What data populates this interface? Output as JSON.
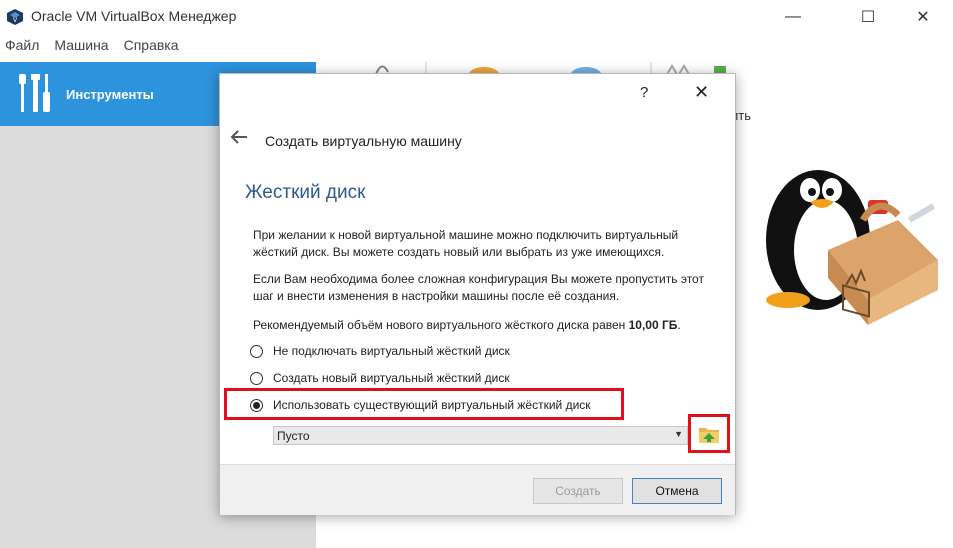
{
  "window": {
    "title": "Oracle VM VirtualBox Менеджер",
    "minimize_glyph": "—",
    "maximize_glyph": "☐",
    "close_glyph": "✕"
  },
  "menu": [
    "Файл",
    "Машина",
    "Справка"
  ],
  "sidebar": {
    "tools_label": "Инструменты"
  },
  "right_panel": {
    "partial_label": "ить"
  },
  "dialog": {
    "help_glyph": "?",
    "close_glyph": "✕",
    "wizard_title": "Создать виртуальную машину",
    "section_title": "Жесткий диск",
    "paragraph1": "При желании к новой виртуальной машине можно подключить виртуальный жёсткий диск. Вы можете создать новый или выбрать из уже имеющихся.",
    "paragraph2": "Если Вам необходима более сложная конфигурация Вы можете пропустить этот шаг и внести изменения в настройки машины после её создания.",
    "paragraph3_prefix": "Рекомендуемый объём нового виртуального жёсткого диска равен",
    "recommended_size": "10,00 ГБ",
    "paragraph3_suffix": ".",
    "options": [
      {
        "label": "Не подключать виртуальный жёсткий диск",
        "checked": false
      },
      {
        "label": "Создать новый виртуальный жёсткий диск",
        "checked": false
      },
      {
        "label": "Использовать существующий виртуальный жёсткий диск",
        "checked": true
      }
    ],
    "disk_select_value": "Пусто",
    "create_label": "Создать",
    "cancel_label": "Отмена"
  },
  "colors": {
    "accent": "#2d93dc",
    "highlight": "#e0101a",
    "section_title": "#2f5a8e"
  }
}
